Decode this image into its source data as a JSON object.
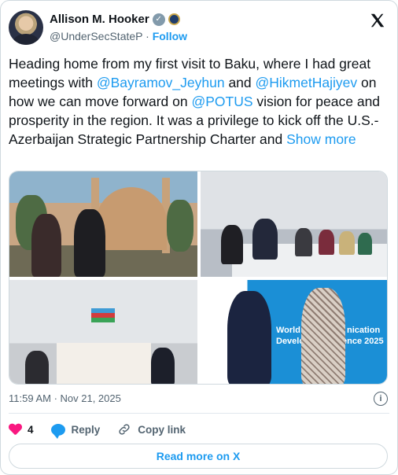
{
  "author": {
    "name": "Allison M. Hooker",
    "handle": "@UnderSecStateP",
    "separator": "·",
    "follow_label": "Follow"
  },
  "tweet": {
    "text_1": "Heading home from my first visit to Baku, where I had great meetings with ",
    "mention_1": "@Bayramov_Jeyhun",
    "text_2": " and ",
    "mention_2": "@HikmetHajiyev",
    "text_3": " on how we can move forward on ",
    "mention_3": "@POTUS",
    "text_4": " vision for peace and prosperity in the region. It was a privilege to kick off the U.S.-Azerbaijan Strategic Partnership Charter and ",
    "show_more": "Show more"
  },
  "media": {
    "banner_line1": "World",
    "banner_line2": "Development",
    "banner_line3": "nication",
    "banner_line4": "ence 2025"
  },
  "meta": {
    "timestamp": "11:59 AM · Nov 21, 2025"
  },
  "actions": {
    "like_count": "4",
    "reply_label": "Reply",
    "copy_link_label": "Copy link"
  },
  "footer": {
    "read_more_label": "Read more on X"
  },
  "colors": {
    "accent": "#1d9bf0",
    "like": "#f91880",
    "muted": "#536471"
  }
}
